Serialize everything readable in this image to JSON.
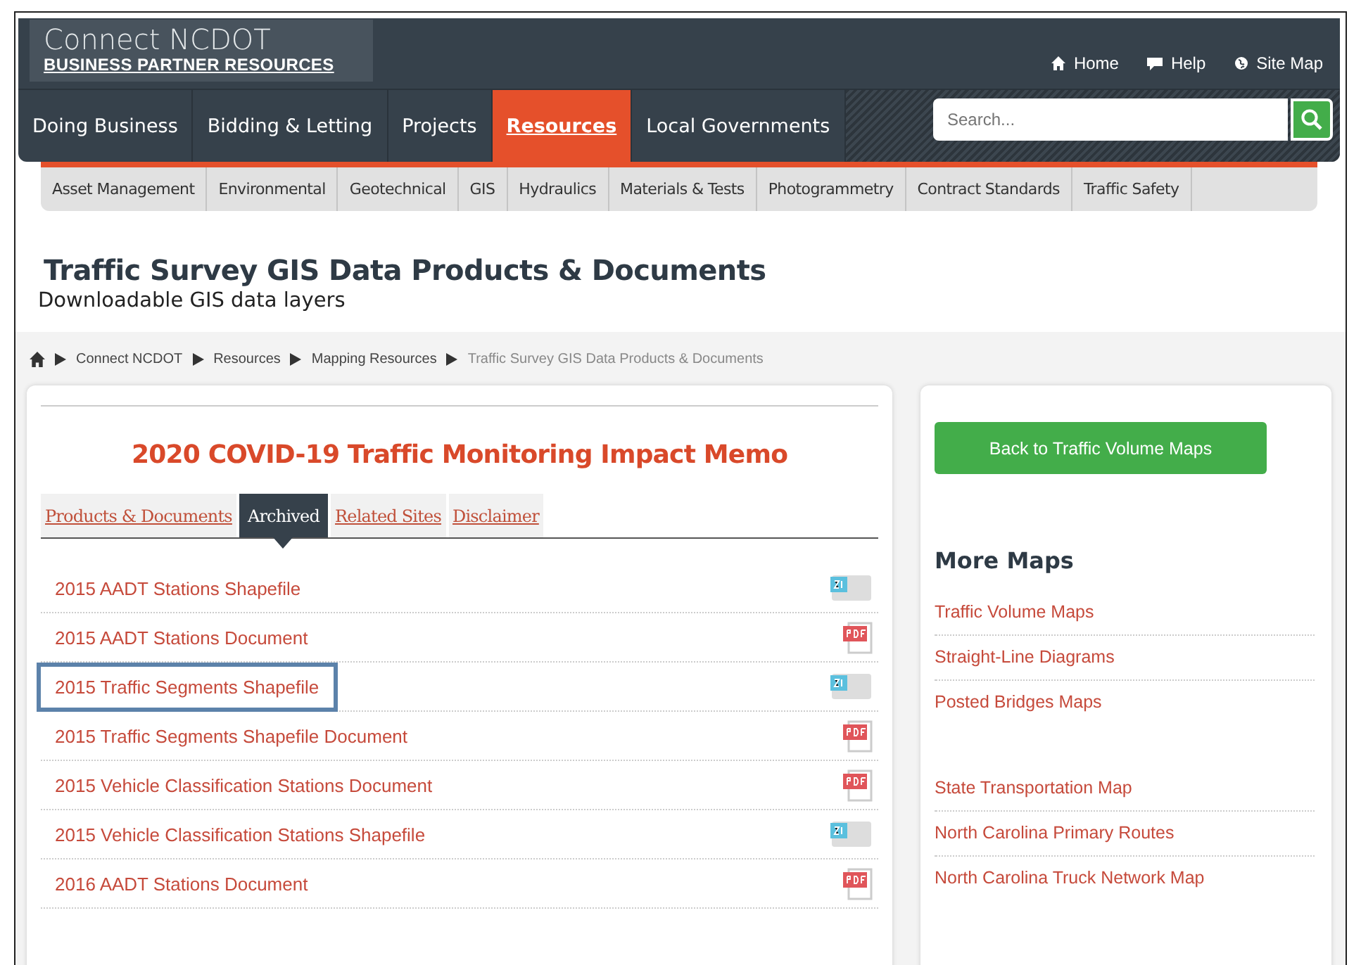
{
  "logo": {
    "title": "Connect NCDOT",
    "subtitle": "BUSINESS PARTNER RESOURCES"
  },
  "top_links": [
    {
      "label": "Home",
      "kind": "home"
    },
    {
      "label": "Help",
      "kind": "help"
    },
    {
      "label": "Site Map",
      "kind": "sitemap"
    }
  ],
  "main_nav": [
    {
      "label": "Doing Business",
      "selected": false
    },
    {
      "label": "Bidding & Letting",
      "selected": false
    },
    {
      "label": "Projects",
      "selected": false
    },
    {
      "label": "Resources",
      "selected": true
    },
    {
      "label": "Local Governments",
      "selected": false
    }
  ],
  "search": {
    "placeholder": "Search..."
  },
  "sub_nav": [
    "Asset Management",
    "Environmental",
    "Geotechnical",
    "GIS",
    "Hydraulics",
    "Materials & Tests",
    "Photogrammetry",
    "Contract Standards",
    "Traffic Safety"
  ],
  "page_title": "Traffic Survey GIS Data Products & Documents",
  "page_subtitle": "Downloadable GIS data layers",
  "breadcrumb": [
    "Connect NCDOT",
    "Resources",
    "Mapping Resources",
    "Traffic Survey GIS Data Products & Documents"
  ],
  "main": {
    "heading": "2020 COVID-19 Traffic Monitoring Impact Memo",
    "tabs": [
      {
        "label": "Products & Documents",
        "selected": false
      },
      {
        "label": "Archived",
        "selected": true
      },
      {
        "label": "Related Sites",
        "selected": false
      },
      {
        "label": "Disclaimer",
        "selected": false
      }
    ],
    "files": [
      {
        "label": "2015 AADT Stations Shapefile",
        "kind": "zip",
        "highlighted": false
      },
      {
        "label": "2015 AADT Stations Document",
        "kind": "pdf",
        "highlighted": false
      },
      {
        "label": "2015 Traffic Segments Shapefile",
        "kind": "zip",
        "highlighted": true
      },
      {
        "label": "2015 Traffic Segments Shapefile Document",
        "kind": "pdf",
        "highlighted": false
      },
      {
        "label": "2015 Vehicle Classification Stations Document",
        "kind": "pdf",
        "highlighted": false
      },
      {
        "label": "2015 Vehicle Classification Stations Shapefile",
        "kind": "zip",
        "highlighted": false
      },
      {
        "label": "2016 AADT Stations Document",
        "kind": "pdf",
        "highlighted": false
      }
    ]
  },
  "sidebar": {
    "button": "Back to Traffic Volume Maps",
    "heading": "More Maps",
    "groups": [
      [
        "Traffic Volume Maps",
        "Straight-Line Diagrams",
        "Posted Bridges Maps"
      ],
      [
        "State Transportation Map",
        "North Carolina Primary Routes",
        "North Carolina Truck Network Map"
      ]
    ]
  }
}
